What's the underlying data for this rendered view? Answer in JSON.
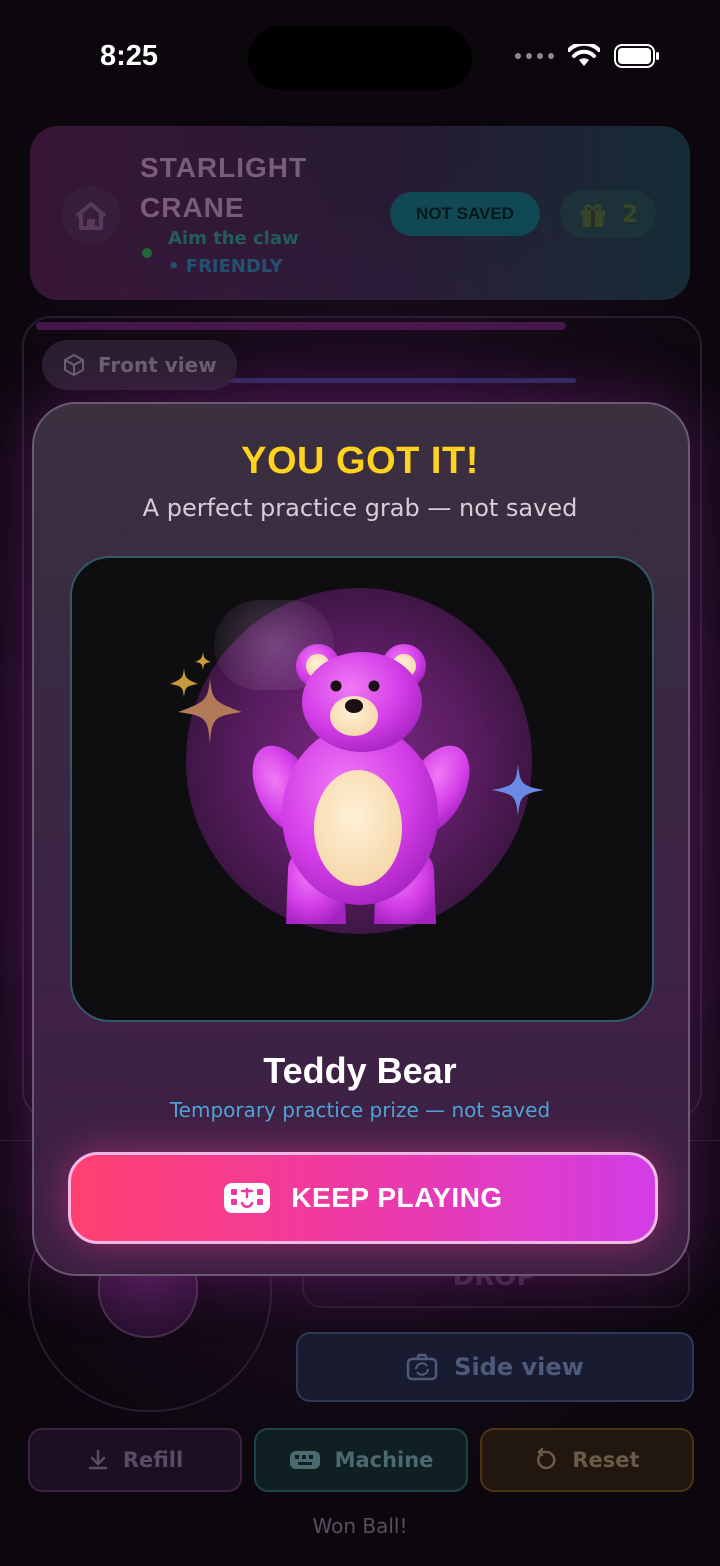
{
  "status_bar": {
    "time": "8:25"
  },
  "header": {
    "title_line1": "STARLIGHT",
    "title_line2": "CRANE",
    "subtitle": "Aim the claw",
    "mode": "• FRIENDLY",
    "save_badge": "NOT SAVED",
    "gift_count": "2"
  },
  "machine": {
    "view_label": "Front view"
  },
  "controls": {
    "drop_label": "DROP",
    "side_view_label": "Side view",
    "refill_label": "Refill",
    "machine_label": "Machine",
    "reset_label": "Reset",
    "status_text": "Won Ball!"
  },
  "modal": {
    "title": "YOU GOT IT!",
    "subtitle": "A perfect practice grab — not saved",
    "prize_name": "Teddy Bear",
    "prize_note": "Temporary practice prize — not saved",
    "button_label": "KEEP PLAYING"
  },
  "colors": {
    "title_yellow": "#ffd21f",
    "bear_pink": "#d43ee8",
    "button_start": "#ff4070",
    "button_end": "#d23de6"
  },
  "icons": [
    "home-icon",
    "gift-icon",
    "cube-icon",
    "camera-rotate-icon",
    "download-icon",
    "gamepad-icon",
    "reset-icon",
    "sparkle-icon",
    "wifi-icon",
    "battery-icon"
  ]
}
